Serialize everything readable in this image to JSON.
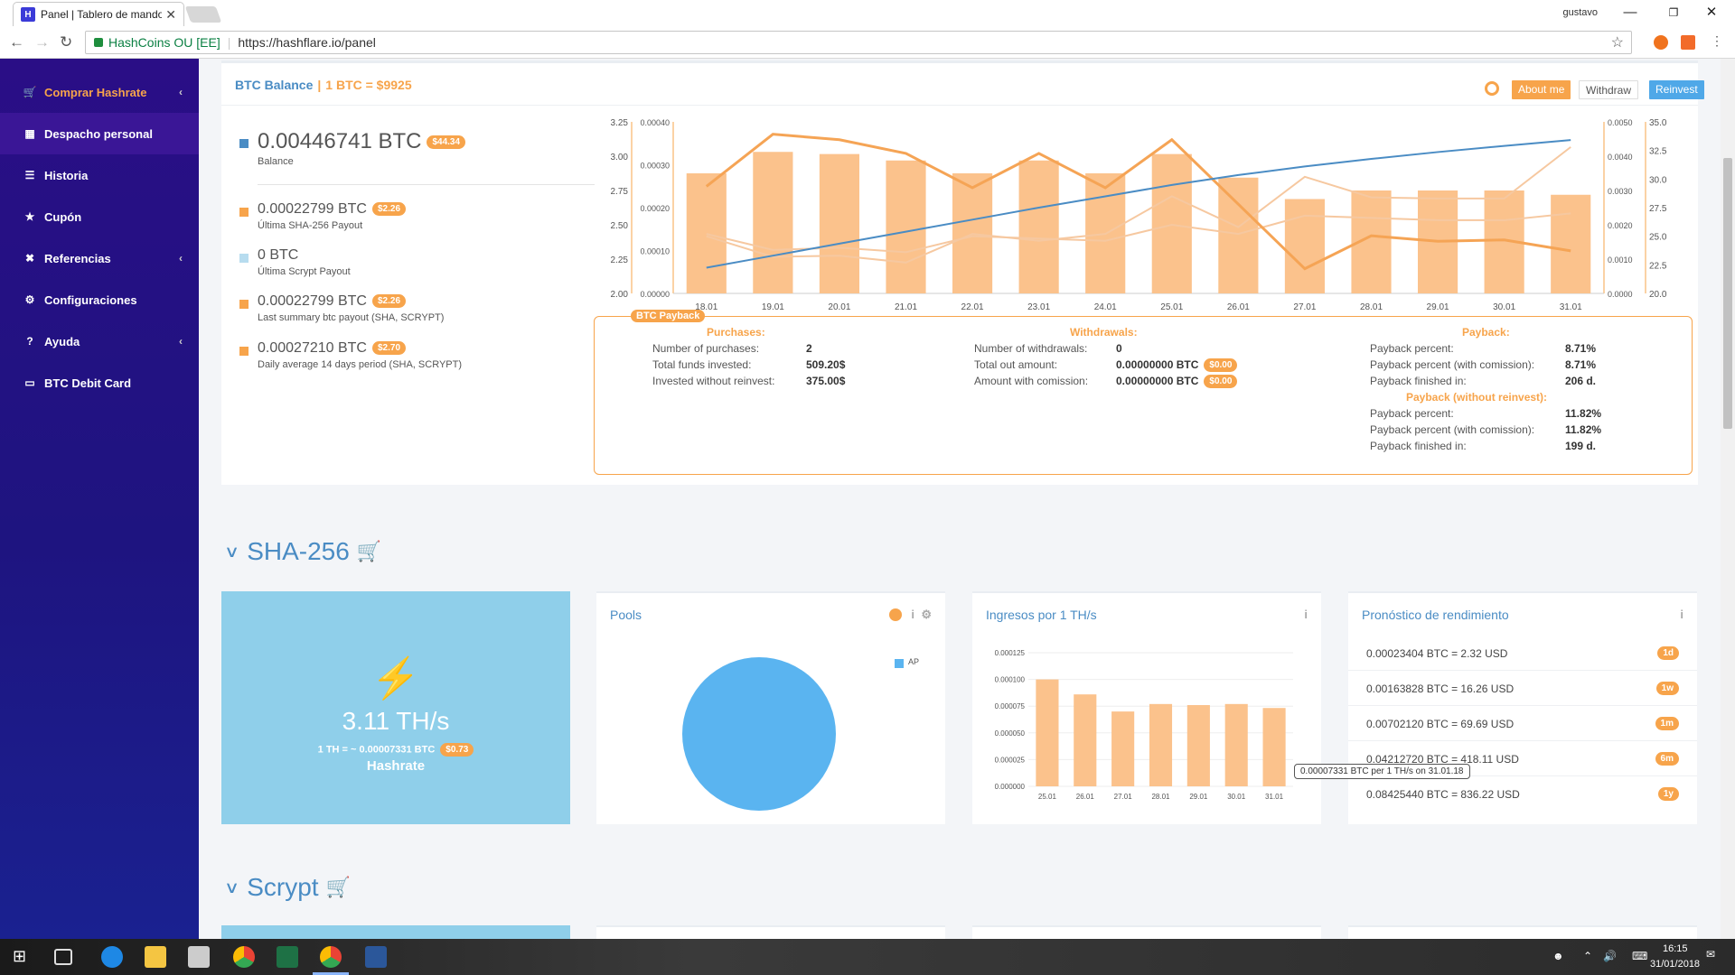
{
  "browser": {
    "tab_title": "Panel | Tablero de mando",
    "tab_close": "✕",
    "user": "gustavo",
    "omnibox": {
      "secure_label": "HashCoins OU [EE]",
      "url": "https://hashflare.io/panel"
    }
  },
  "sidebar": {
    "items": [
      {
        "label": "Comprar Hashrate",
        "icon": "cart-icon"
      },
      {
        "label": "Despacho personal",
        "icon": "dashboard-icon"
      },
      {
        "label": "Historia",
        "icon": "list-icon"
      },
      {
        "label": "Cupón",
        "icon": "star-icon"
      },
      {
        "label": "Referencias",
        "icon": "share-icon"
      },
      {
        "label": "Configuraciones",
        "icon": "gears-icon"
      },
      {
        "label": "Ayuda",
        "icon": "question-icon"
      },
      {
        "label": "BTC Debit Card",
        "icon": "card-icon"
      }
    ]
  },
  "balance": {
    "title": "BTC Balance",
    "separator": "|",
    "rate": "1 BTC = $9925",
    "buttons": {
      "about": "About me",
      "withdraw": "Withdraw",
      "reinvest": "Reinvest"
    },
    "rows": [
      {
        "value": "0.00446741 BTC",
        "badge": "$44.34",
        "label": "Balance",
        "color": "#4a8cc4"
      },
      {
        "value": "0.00022799 BTC",
        "badge": "$2.26",
        "label": "Última SHA-256 Payout",
        "color": "#f7a44b"
      },
      {
        "value": "0 BTC",
        "badge": "",
        "label": "Última Scrypt Payout",
        "color": "#b7dcef"
      },
      {
        "value": "0.00022799 BTC",
        "badge": "$2.26",
        "label": "Last summary btc payout (SHA, SCRYPT)",
        "color": "#f7a44b"
      },
      {
        "value": "0.00027210 BTC",
        "badge": "$2.70",
        "label": "Daily average 14 days period (SHA, SCRYPT)",
        "color": "#f7a44b"
      }
    ]
  },
  "chart_data": {
    "type": "bar",
    "categories": [
      "18.01",
      "19.01",
      "20.01",
      "21.01",
      "22.01",
      "23.01",
      "24.01",
      "25.01",
      "26.01",
      "27.01",
      "28.01",
      "29.01",
      "30.01",
      "31.01"
    ],
    "y_left_outer_ticks": [
      "3.25",
      "3.00",
      "2.75",
      "2.50",
      "2.25",
      "2.00"
    ],
    "y_left_inner_ticks": [
      "0.00040",
      "0.00030",
      "0.00020",
      "0.00010",
      "0.00000"
    ],
    "y_right_inner_ticks": [
      "0.0050",
      "0.0040",
      "0.0030",
      "0.0020",
      "0.0010",
      "0.0000"
    ],
    "y_right_outer_ticks": [
      "35.0",
      "32.5",
      "30.0",
      "27.5",
      "25.0",
      "22.5",
      "20.0"
    ],
    "ylim": [
      0,
      0.0004
    ],
    "series": [
      {
        "values": [
          0.00028,
          0.00033,
          0.000325,
          0.00031,
          0.00028,
          0.00031,
          0.00028,
          0.000325,
          0.00027,
          0.00022,
          0.00024,
          0.00024,
          0.00024,
          0.00023
        ]
      },
      {
        "values": [
          0.00075,
          0.0011,
          0.00145,
          0.0018,
          0.00215,
          0.0025,
          0.00283,
          0.00316,
          0.00345,
          0.0037,
          0.00392,
          0.00412,
          0.0043,
          0.00447
        ]
      },
      {
        "values": [
          2.78,
          3.16,
          3.12,
          3.02,
          2.77,
          3.02,
          2.77,
          3.12,
          2.65,
          2.18,
          2.42,
          2.38,
          2.39,
          2.31
        ]
      },
      {
        "values": [
          25.0,
          23.2,
          23.3,
          22.7,
          25.2,
          24.6,
          25.2,
          28.5,
          25.8,
          30.2,
          28.4,
          28.3,
          28.3,
          32.8
        ]
      },
      {
        "values": [
          25.2,
          23.8,
          24.0,
          23.6,
          25.0,
          24.8,
          24.6,
          26.0,
          25.2,
          26.8,
          26.6,
          26.4,
          26.4,
          27.0
        ]
      }
    ],
    "colors": {
      "bar": "#fbc28c",
      "line_orange": "#f5a455",
      "line_light": "#f6c8a0",
      "line_blue": "#4a8cc4"
    }
  },
  "payback": {
    "legend": "BTC Payback",
    "purchases": {
      "heading": "Purchases:",
      "rows": [
        {
          "label": "Number of purchases:",
          "value": "2"
        },
        {
          "label": "Total funds invested:",
          "value": "509.20$"
        },
        {
          "label": "Invested without reinvest:",
          "value": "375.00$"
        }
      ]
    },
    "withdrawals": {
      "heading": "Withdrawals:",
      "rows": [
        {
          "label": "Number of withdrawals:",
          "value": "0",
          "badge": ""
        },
        {
          "label": "Total out amount:",
          "value": "0.00000000 BTC",
          "badge": "$0.00"
        },
        {
          "label": "Amount with comission:",
          "value": "0.00000000 BTC",
          "badge": "$0.00"
        }
      ]
    },
    "payback": {
      "heading": "Payback:",
      "rows": [
        {
          "label": "Payback percent:",
          "value": "8.71%"
        },
        {
          "label": "Payback percent (with comission):",
          "value": "8.71%"
        },
        {
          "label": "Payback finished in:",
          "value": "206 d."
        }
      ],
      "heading2": "Payback (without reinvest):",
      "rows2": [
        {
          "label": "Payback percent:",
          "value": "11.82%"
        },
        {
          "label": "Payback percent (with comission):",
          "value": "11.82%"
        },
        {
          "label": "Payback finished in:",
          "value": "199 d."
        }
      ]
    }
  },
  "sha": {
    "title": "SHA-256",
    "hashrate": "3.11 TH/s",
    "per_th": "1 TH = ~ 0.00007331 BTC",
    "per_badge": "$0.73",
    "hashrate_label": "Hashrate",
    "pools": {
      "title": "Pools",
      "legend": "AP",
      "values": [
        100
      ]
    },
    "income": {
      "title": "Ingresos por 1 TH/s",
      "categories": [
        "25.01",
        "26.01",
        "27.01",
        "28.01",
        "29.01",
        "30.01",
        "31.01"
      ],
      "values": [
        0.0001,
        8.6e-05,
        7e-05,
        7.7e-05,
        7.6e-05,
        7.7e-05,
        7.33e-05
      ],
      "yticks": [
        "0.000125",
        "0.000100",
        "0.000075",
        "0.000050",
        "0.000025",
        "0.000000"
      ],
      "tooltip": "0.00007331 BTC per 1 TH/s on 31.01.18"
    },
    "forecast": {
      "title": "Pronóstico de rendimiento",
      "rows": [
        {
          "text": "0.00023404 BTC = 2.32 USD",
          "badge": "1d"
        },
        {
          "text": "0.00163828 BTC = 16.26 USD",
          "badge": "1w"
        },
        {
          "text": "0.00702120 BTC = 69.69 USD",
          "badge": "1m"
        },
        {
          "text": "0.04212720 BTC = 418.11 USD",
          "badge": "6m"
        },
        {
          "text": "0.08425440 BTC = 836.22 USD",
          "badge": "1y"
        }
      ]
    }
  },
  "scrypt": {
    "title": "Scrypt"
  },
  "taskbar": {
    "time": "16:15",
    "date": "31/01/2018"
  }
}
